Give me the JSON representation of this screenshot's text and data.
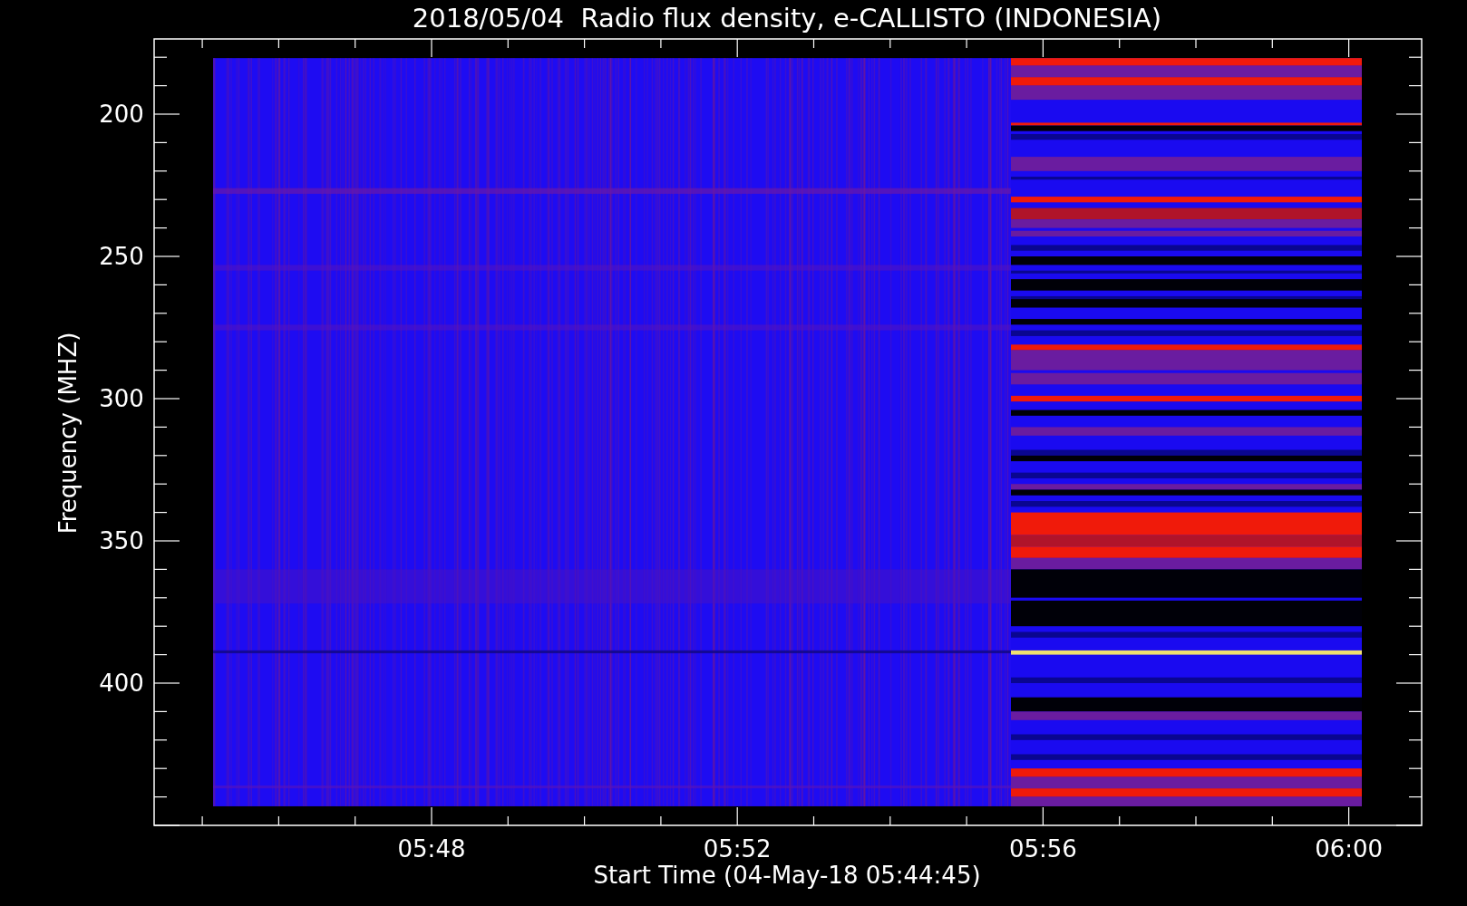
{
  "plot": {
    "title": "2018/05/04  Radio flux density, e-CALLISTO (INDONESIA)",
    "xlabel": "Start Time (04-May-18 05:44:45)",
    "ylabel": "Frequency (MHZ)",
    "y_tick_labels": [
      "200",
      "250",
      "300",
      "350",
      "400"
    ],
    "x_tick_labels": [
      "05:48",
      "05:52",
      "05:56",
      "06:00"
    ]
  }
}
